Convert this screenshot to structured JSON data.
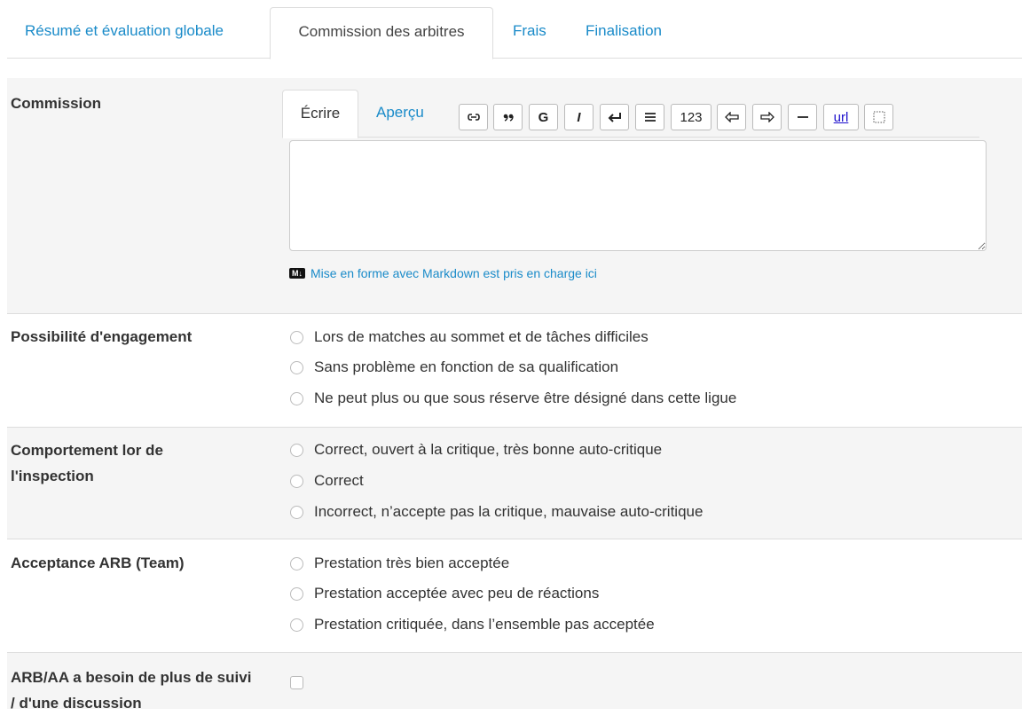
{
  "tabs": [
    {
      "label": "Résumé et évaluation globale"
    },
    {
      "label": "Commission des arbitres"
    },
    {
      "label": "Frais"
    },
    {
      "label": "Finalisation"
    }
  ],
  "commission": {
    "label": "Commission",
    "editor": {
      "write_tab": "Écrire",
      "preview_tab": "Aperçu",
      "toolbar": {
        "bold": "G",
        "italic": "I",
        "numbered": "123",
        "url": "url"
      },
      "value": "",
      "markdown_badge": "M↓",
      "markdown_note": "Mise en forme avec Markdown est pris en charge ici"
    }
  },
  "engagement": {
    "label": "Possibilité d'engagement",
    "options": [
      "Lors de matches au sommet et de tâches difficiles",
      "Sans problème en fonction de sa qualification",
      "Ne peut plus ou que sous réserve être désigné dans cette ligue"
    ]
  },
  "behavior": {
    "label": "Comportement lor de l'inspection",
    "options": [
      "Correct, ouvert à la critique, très bonne auto-critique",
      "Correct",
      "Incorrect, n’accepte pas la critique, mauvaise auto-critique"
    ]
  },
  "acceptance": {
    "label": "Acceptance ARB (Team)",
    "options": [
      "Prestation très bien acceptée",
      "Prestation acceptée avec peu de réactions",
      "Prestation critiquée, dans l’ensemble pas acceptée"
    ]
  },
  "followup": {
    "label": "ARB/AA a besoin de plus de suivi / d'une discussion",
    "checked": false
  },
  "colors": {
    "link": "#1a8bc9",
    "panel_bg": "#f5f5f5",
    "text": "#333333"
  }
}
